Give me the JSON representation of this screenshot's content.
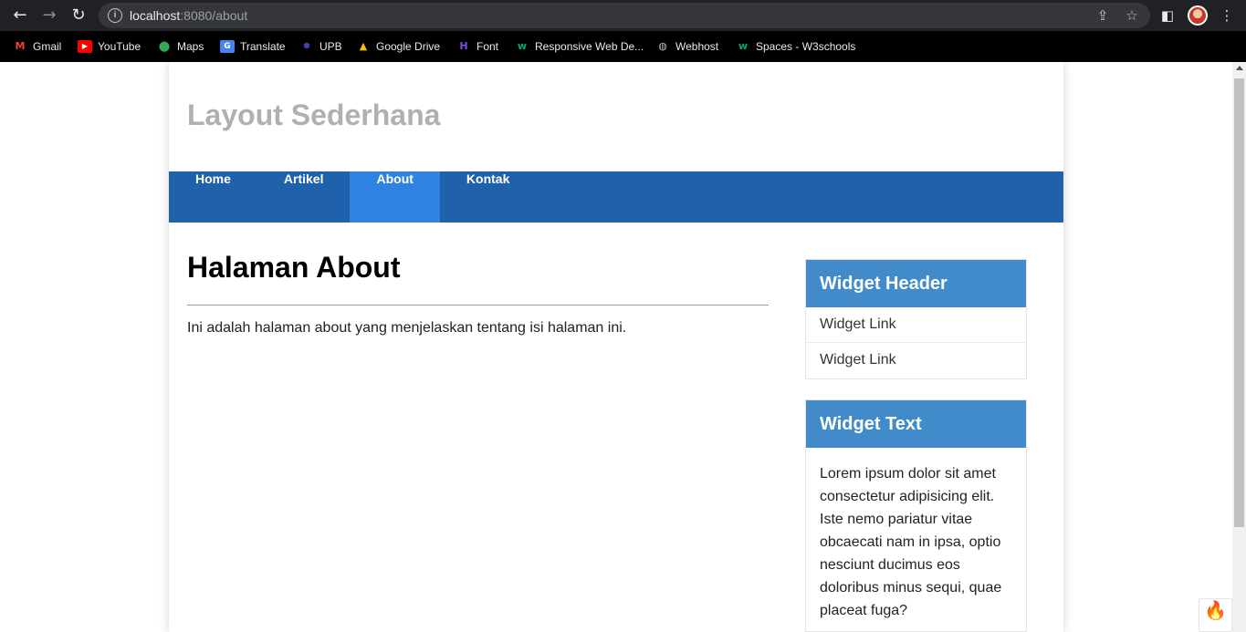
{
  "browser": {
    "url_host": "localhost",
    "url_rest": ":8080/about",
    "bookmarks": [
      {
        "label": "Gmail",
        "icon": "gmail-icon"
      },
      {
        "label": "YouTube",
        "icon": "youtube-icon"
      },
      {
        "label": "Maps",
        "icon": "maps-icon"
      },
      {
        "label": "Translate",
        "icon": "translate-icon"
      },
      {
        "label": "UPB",
        "icon": "upb-icon"
      },
      {
        "label": "Google Drive",
        "icon": "google-drive-icon"
      },
      {
        "label": "Font",
        "icon": "font-icon"
      },
      {
        "label": "Responsive Web De...",
        "icon": "w3schools-icon"
      },
      {
        "label": "Webhost",
        "icon": "globe-icon"
      },
      {
        "label": "Spaces - W3schools",
        "icon": "w3schools-icon"
      }
    ]
  },
  "site": {
    "title": "Layout Sederhana",
    "menu": [
      {
        "label": "Home",
        "active": false
      },
      {
        "label": "Artikel",
        "active": false
      },
      {
        "label": "About",
        "active": true
      },
      {
        "label": "Kontak",
        "active": false
      }
    ]
  },
  "main": {
    "heading": "Halaman About",
    "text": "Ini adalah halaman about yang menjelaskan tentang isi halaman ini."
  },
  "sidebar": {
    "widget1": {
      "header": "Widget Header",
      "links": [
        "Widget Link",
        "Widget Link"
      ]
    },
    "widget2": {
      "header": "Widget Text",
      "body": "Lorem ipsum dolor sit amet consectetur adipisicing elit. Iste nemo pariatur vitae obcaecati nam in ipsa, optio nesciunt ducimus eos doloribus minus sequi, quae placeat fuga?"
    }
  },
  "colors": {
    "menu_bg": "#2061ab",
    "menu_active": "#2f82e0",
    "widget_header": "#428bca",
    "site_title": "#b0b0b0"
  }
}
